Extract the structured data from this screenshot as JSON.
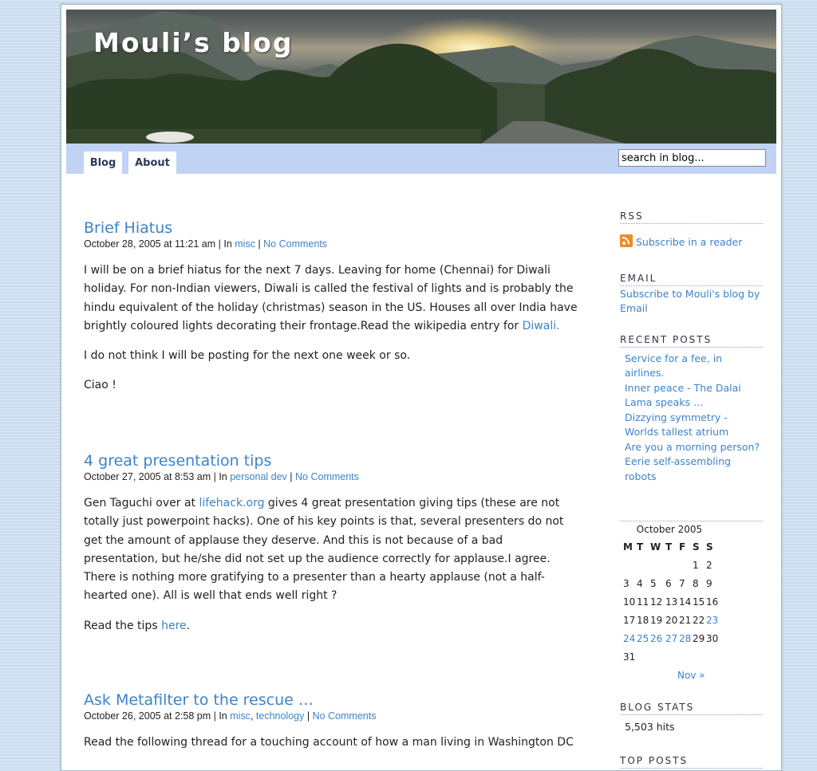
{
  "header": {
    "title": "Mouli’s blog"
  },
  "nav": {
    "tabs": [
      {
        "label": "Blog"
      },
      {
        "label": "About"
      }
    ]
  },
  "search": {
    "placeholder": "search in blog...",
    "value": "search in blog..."
  },
  "posts": [
    {
      "title": "Brief Hiatus",
      "meta_prefix": "October 28, 2005 at 11:21 am | In ",
      "categories": [
        "misc"
      ],
      "comments": "No Comments",
      "p1": "I will be on a brief hiatus for the next 7 days. Leaving for home (Chennai) for Diwali holiday. For non-Indian viewers, Diwali is called the festival of lights and is probably the hindu equivalent of the holiday (christmas) season in the US. Houses all over India have brightly coloured lights decorating their frontage.Read the wikipedia entry for ",
      "p1_link": "Diwali.",
      "p2": "I do not think I will be posting for the next one week or so.",
      "p3": "Ciao !"
    },
    {
      "title": "4 great presentation tips",
      "meta_prefix": "October 27, 2005 at 8:53 am | In ",
      "categories": [
        "personal dev"
      ],
      "comments": "No Comments",
      "p1_a": "Gen Taguchi over at ",
      "p1_link": "lifehack.org",
      "p1_b": " gives 4 great presentation giving tips (these are not totally just powerpoint hacks). One of his key points is that, several presenters do not get the amount of applause they deserve. And this is not because of a bad presentation, but he/she did not set up the audience correctly for applause.I agree. There is nothing more gratifying to a presenter than a hearty applause (not a half-hearted one). All is well that ends well right ?",
      "p2_a": "Read the tips ",
      "p2_link": "here",
      "p2_b": "."
    },
    {
      "title": "Ask Metafilter to the rescue …",
      "meta_prefix": "October 26, 2005 at 2:58 pm | In ",
      "categories": [
        "misc",
        "technology"
      ],
      "comments": "No Comments",
      "p1": "Read the following thread for a touching account of how a man living in Washington DC"
    }
  ],
  "sidebar": {
    "rss": {
      "heading": "RSS",
      "link": "Subscribe in a reader"
    },
    "email": {
      "heading": "EMAIL",
      "link": "Subscribe to Mouli's blog by Email"
    },
    "recent": {
      "heading": "RECENT POSTS",
      "items": [
        "Service for a fee, in airlines.",
        "Inner peace - The Dalai Lama speaks …",
        "Dizzying symmetry - Worlds tallest atrium",
        "Are you a morning person?",
        "Eerie self-assembling robots"
      ]
    },
    "calendar": {
      "caption": "October 2005",
      "weekdays": [
        "M",
        "T",
        "W",
        "T",
        "F",
        "S",
        "S"
      ],
      "first_weekday_index": 5,
      "days_in_month": 31,
      "linked_days": [
        23,
        24,
        25,
        26,
        27,
        28
      ],
      "next": "Nov »"
    },
    "stats": {
      "heading": "BLOG STATS",
      "hits": "5,503 hits"
    },
    "top": {
      "heading": "TOP POSTS"
    }
  },
  "colors": {
    "link": "#3c83c9",
    "nav_bg": "#c0d3f5",
    "page_bg": "#c9dcef"
  }
}
